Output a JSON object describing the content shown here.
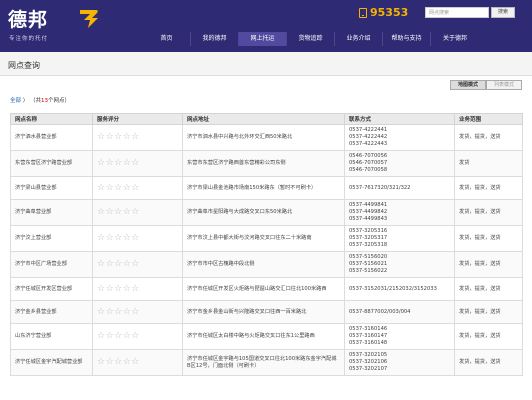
{
  "header": {
    "logo_text": "德邦",
    "slogan": "专注你的托付",
    "hotline": "95353",
    "search_placeholder": "网点搜索",
    "search_button": "搜索",
    "colors": {
      "brand": "#2f2a74",
      "accent": "#f6b400"
    }
  },
  "nav": {
    "items": [
      {
        "label": "首页"
      },
      {
        "label": "我的德邦"
      },
      {
        "label": "网上托运"
      },
      {
        "label": "货物追踪"
      },
      {
        "label": "业务介绍"
      },
      {
        "label": "帮助与支持"
      },
      {
        "label": "关于德邦"
      }
    ]
  },
  "page": {
    "title": "网点查询",
    "view_map": "地图模式",
    "view_list": "列表模式"
  },
  "crumb": {
    "root": "全部",
    "arrow": "〉",
    "prefix": "（共",
    "count": "13",
    "suffix": "个网点）"
  },
  "table": {
    "headers": [
      "网点名称",
      "服务评分",
      "网点地址",
      "联系方式",
      "业务范围"
    ],
    "rows": [
      {
        "name": "济宁泗水县营业部",
        "address": "济宁市泗水县中兴路与北外环交汇西50米路北",
        "phones": [
          "0537-4222441",
          "0537-4222442",
          "0537-4222443"
        ],
        "services": [
          "发货",
          "提货",
          "送货"
        ]
      },
      {
        "name": "东营东营区济宁路营业部",
        "address": "东营市东营区济宁路西首东营精彩公司东侧",
        "phones": [
          "0546-7070056",
          "0546-7070057",
          "0546-7070058"
        ],
        "services": [
          "发货"
        ]
      },
      {
        "name": "济宁梁山县营业部",
        "address": "济宁市梁山县金池路市场南150米路东（暂时不可刷卡）",
        "phones": [
          "0537-7617320/321/322"
        ],
        "services": [
          "发货",
          "提货",
          "送货"
        ]
      },
      {
        "name": "济宁曲阜营业部",
        "address": "济宁曲阜市星阳路与大成路交叉口东50米路北",
        "phones": [
          "0537-4499841",
          "0537-4499842",
          "0537-4499843"
        ],
        "services": [
          "发货",
          "提货",
          "送货"
        ]
      },
      {
        "name": "济宁汶上营业部",
        "address": "济宁市汶上县中都大街与汶河路交叉口往东二十米路南",
        "phones": [
          "0537-3205316",
          "0537-3205317",
          "0537-3205318"
        ],
        "services": [
          "发货",
          "提货",
          "送货"
        ]
      },
      {
        "name": "济宁市中区广场营业部",
        "address": "济宁市市中区古槐路中段北侧",
        "phones": [
          "0537-5156020",
          "0537-5156021",
          "0537-5156022"
        ],
        "services": [
          "发货",
          "提货",
          "送货"
        ]
      },
      {
        "name": "济宁任城区开发区营业部",
        "address": "济宁市任城区开发区火炬路与琵琶山路交汇口往北100米路西",
        "phones": [
          "0537-3152031/2152032/3152033"
        ],
        "services": [
          "发货",
          "提货",
          "送货"
        ]
      },
      {
        "name": "济宁金乡县营业部",
        "address": "济宁市金乡县金山街与兴隆路交叉口往西一百米路北",
        "phones": [
          "0537-8877002/003/004"
        ],
        "services": [
          "发货",
          "提货",
          "送货"
        ]
      },
      {
        "name": "山东济宁营业部",
        "address": "济宁市任城区太白楼中路与火炬路交叉口往东1公里路西",
        "phones": [
          "0537-3160146",
          "0537-3160147",
          "0537-3160148"
        ],
        "services": [
          "发货",
          "提货",
          "送货"
        ]
      },
      {
        "name": "济宁任城区金宇汽配城营业部",
        "address": "济宁市任城区金宇路与105国道交叉口往北100米路东金宇汽配城B区12号，门面北侧（可刷卡）",
        "phones": [
          "0537-3202105",
          "0537-3202106",
          "0537-3202107"
        ],
        "services": [
          "发货",
          "提货",
          "送货"
        ]
      }
    ]
  }
}
